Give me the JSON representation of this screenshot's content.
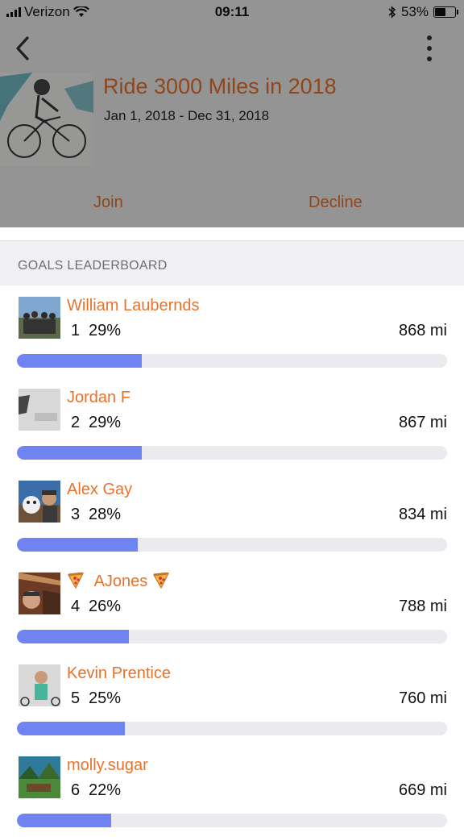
{
  "status_bar": {
    "carrier": "Verizon",
    "time": "09:11",
    "battery": "53%"
  },
  "nav": {
    "back_icon": "chevron-left-icon",
    "more_icon": "vertical-dots-icon"
  },
  "challenge": {
    "title": "Ride 3000 Miles in 2018",
    "dates": "Jan 1, 2018 - Dec 31, 2018",
    "join_label": "Join",
    "decline_label": "Decline"
  },
  "leaderboard": {
    "header": "GOALS LEADERBOARD",
    "entries": [
      {
        "name": "William Laubernds",
        "rank": "1",
        "percent": "29%",
        "distance": "868 mi",
        "progress": 0.29
      },
      {
        "name": "Jordan F",
        "rank": "2",
        "percent": "29%",
        "distance": "867 mi",
        "progress": 0.29
      },
      {
        "name": "Alex Gay",
        "rank": "3",
        "percent": "28%",
        "distance": "834 mi",
        "progress": 0.28
      },
      {
        "name": "AJones",
        "rank": "4",
        "percent": "26%",
        "distance": "788 mi",
        "progress": 0.26
      },
      {
        "name": "Kevin Prentice",
        "rank": "5",
        "percent": "25%",
        "distance": "760 mi",
        "progress": 0.25
      },
      {
        "name": "molly.sugar",
        "rank": "6",
        "percent": "22%",
        "distance": "669 mi",
        "progress": 0.22
      }
    ]
  },
  "colors": {
    "accent": "#e8722a",
    "progress_fill": "#6f84f0",
    "progress_track": "#eaeaef"
  }
}
